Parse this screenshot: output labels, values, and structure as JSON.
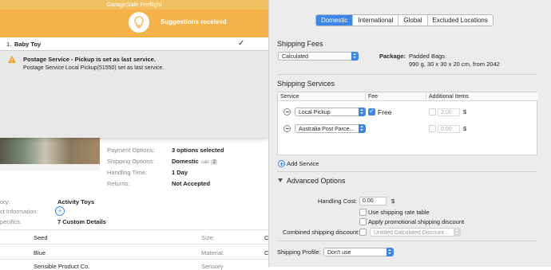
{
  "dialog": {
    "title": "GarageSale Preflight",
    "banner": "Suggestions received",
    "list": [
      {
        "number": "1.",
        "name": "Baby Toy",
        "check": "✓"
      }
    ],
    "warning": {
      "title": "Postage Service - Pickup is set as last service.",
      "text": "Postage Service Local Pickup(51550) set as last service."
    }
  },
  "listing": {
    "rows": [
      {
        "label": "Payment Options:",
        "value": "3 options selected"
      },
      {
        "label": "Shipping Options:",
        "value": "Domestic",
        "calc": "calc",
        "badge": "2"
      },
      {
        "label": "Handling Time:",
        "value": "1 Day"
      },
      {
        "label": "Returns:",
        "value": "Not Accepted"
      }
    ],
    "details": {
      "category_label": "ory:",
      "category_value": "Activity Toys",
      "info_label": "ct Information:",
      "specifics_label": "pecifics:",
      "specifics_value": "7 Custom Details"
    },
    "specifics_table": {
      "r1c1": "Seed",
      "r1c2": "Size:",
      "r1c3": "C",
      "r2c1": "Blue",
      "r2c2": "Material:",
      "r2c3": "C",
      "r3c1": "Sensible Product Co.",
      "r3c2": "Sensory"
    }
  },
  "pane": {
    "tabs": [
      "Domestic",
      "International",
      "Global",
      "Excluded Locations"
    ],
    "active_tab": "Domestic",
    "shipping_fees": {
      "title": "Shipping Fees",
      "type_value": "Calculated",
      "package_label": "Package:",
      "package_line1": "Padded Bags",
      "package_line2": "990 g, 30 x 30 x 20 cm, from 2042"
    },
    "shipping_services": {
      "title": "Shipping Services",
      "columns": [
        "Service",
        "Fee",
        "Additional Items"
      ],
      "rows": [
        {
          "service": "Local Pickup",
          "free_checked": true,
          "free_label": "Free",
          "additional": "2.00",
          "currency": "$"
        },
        {
          "service": "Australia Post Parce...",
          "free_checked": false,
          "free_label": "",
          "additional": "0.00",
          "currency": "$"
        }
      ],
      "add_label": "Add Service"
    },
    "advanced": {
      "title": "Advanced Options",
      "handling_cost_label": "Handling Cost:",
      "handling_cost_value": "0.00",
      "currency": "$",
      "use_rate_table": "Use shipping rate table",
      "apply_promo": "Apply promotional shipping discount",
      "combined_label": "Combined shipping discount:",
      "combined_value": "Untitled Calculated Discount...",
      "profile_label": "Shipping Profile:",
      "profile_value": "Don't use"
    }
  }
}
